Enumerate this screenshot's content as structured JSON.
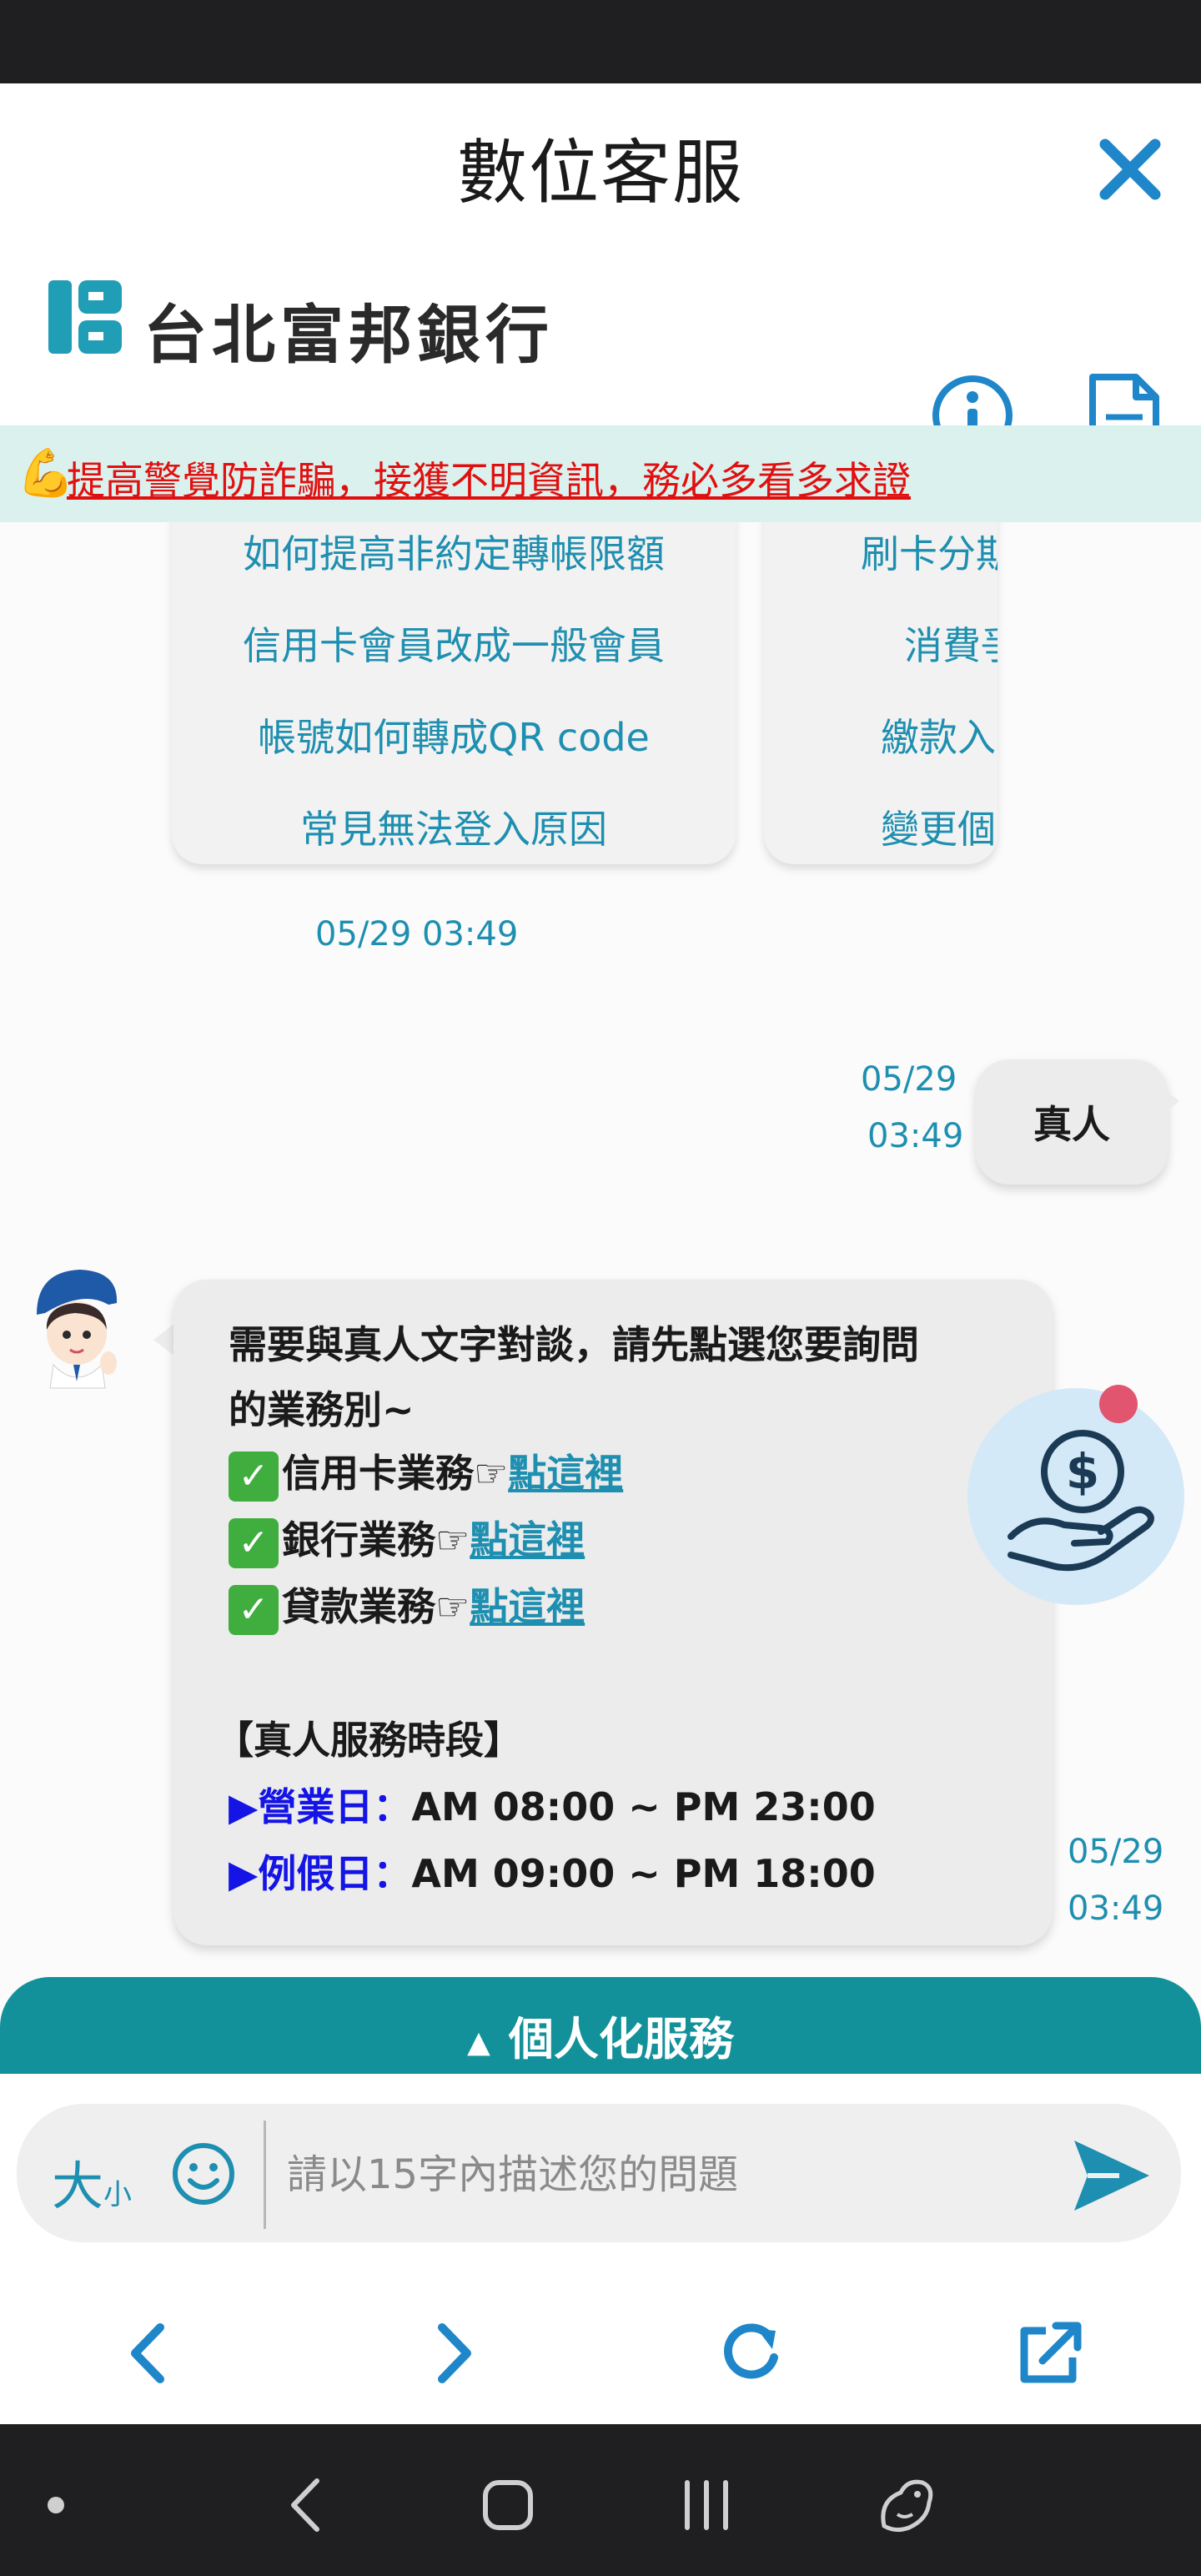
{
  "header": {
    "title": "數位客服",
    "bank_name": "台北富邦銀行"
  },
  "alert": {
    "icon": "flexed-biceps",
    "text": "提高警覺防詐騙，接獲不明資訊，務必多看多求證"
  },
  "faq_cards": [
    {
      "items": [
        "如何提高非約定轉帳限額",
        "信用卡會員改成一般會員",
        "帳號如何轉成QR code",
        "常見無法登入原因"
      ]
    },
    {
      "items": [
        "刷卡分期",
        "消費爭",
        "繳款入",
        "變更個"
      ]
    }
  ],
  "messages": {
    "faq_timestamp": "05/29 03:49",
    "user_message": {
      "text": "真人",
      "date": "05/29",
      "time": "03:49"
    },
    "bot_message": {
      "intro_line1": "需要與真人文字對談，請先點選您要詢問",
      "intro_line2": "的業務別~",
      "options": [
        {
          "label": "信用卡業務☞",
          "link": "點這裡"
        },
        {
          "label": "銀行業務☞",
          "link": "點這裡"
        },
        {
          "label": "貸款業務☞",
          "link": "點這裡"
        }
      ],
      "hours_title": "【真人服務時段】",
      "weekday_label": "▶營業日：",
      "weekday_hours": "AM 08:00 ~ PM 23:00",
      "holiday_label": "▶例假日：",
      "holiday_hours": "AM 09:00 ~ PM 18:00",
      "date": "05/29",
      "time": "03:49"
    }
  },
  "personal_service": {
    "label": "個人化服務"
  },
  "input": {
    "font_size_large": "大",
    "font_size_small": "小",
    "placeholder": "請以15字內描述您的問題"
  },
  "colors": {
    "accent": "#1e8fb0",
    "teal_bar": "#12919a",
    "alert_bg": "#dbf1ee",
    "alert_text": "#e01010",
    "hours_label": "#1414e6"
  }
}
